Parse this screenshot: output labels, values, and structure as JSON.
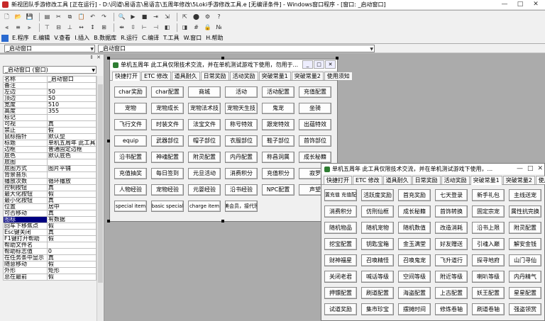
{
  "app_title": "新视团队手游修改工具 [正在运行] - D:\\问道\\易语言\\易语言\\五周年修改\\5Loki手游修改工具.e [无编译条件] - Windows窗口程序 - [窗口: _启动窗口]",
  "window_controls": [
    "—",
    "□",
    "✕"
  ],
  "toolbar1_icons": [
    "new-icon",
    "open-icon",
    "save-icon",
    "save-all-icon",
    "cut-icon",
    "copy-icon",
    "paste-icon",
    "undo-icon",
    "redo-icon",
    "find-icon",
    "run-icon",
    "stop-icon",
    "step-icon",
    "step-over-icon",
    "step-out-icon",
    "breakpoint-icon",
    "compile-icon",
    "help-icon"
  ],
  "toolbar1_glyphs": [
    "🗋",
    "📂",
    "💾",
    "▤",
    "✂",
    "⧉",
    "📋",
    "↶",
    "↷",
    "🔍",
    "▶",
    "■",
    "⇥",
    "⇲",
    "⇱",
    "⬤",
    "⚙",
    "?"
  ],
  "toolbar2_icons": [
    "align-left-icon",
    "align-center-icon",
    "align-right-icon",
    "align-top-icon",
    "align-middle-icon",
    "align-bottom-icon",
    "same-width-icon",
    "same-height-icon",
    "same-size-icon",
    "space-h-icon",
    "space-v-icon",
    "center-h-icon",
    "center-v-icon",
    "bring-front-icon",
    "send-back-icon",
    "grid-icon",
    "lock-icon",
    "tab-order-icon"
  ],
  "toolbar2_glyphs": [
    "⫷",
    "≡",
    "⫸",
    "⊤",
    "⊟",
    "⊥",
    "↔",
    "↕",
    "⊞",
    "⇹",
    "⇳",
    "⊢",
    "⊣",
    "◧",
    "◨",
    "#",
    "🔒",
    "№"
  ],
  "menu": [
    "E.程序",
    "E.编辑",
    "V.查看",
    "I.插入",
    "B.数据库",
    "R.运行",
    "C.编译",
    "T.工具",
    "W.窗口",
    "H.帮助"
  ],
  "object_combo": "_启动窗口",
  "event_combo": "_启动窗口",
  "panel_controls": [
    "⇕",
    "✕"
  ],
  "props_combo": "_启动窗口 (窗口)",
  "properties": [
    [
      "名称",
      "_启动窗口"
    ],
    [
      "备注",
      ""
    ],
    [
      "左边",
      "50"
    ],
    [
      "顶边",
      "50"
    ],
    [
      "宽度",
      "510"
    ],
    [
      "高度",
      "355"
    ],
    [
      "标记",
      ""
    ],
    [
      "可视",
      "真"
    ],
    [
      "禁止",
      "假"
    ],
    [
      "鼠标指针",
      "默认型"
    ],
    [
      "标题",
      "单机五周年 此工具"
    ],
    [
      "边框",
      "普通固定边框"
    ],
    [
      "底色",
      "默认底色"
    ],
    [
      "底图",
      ""
    ],
    [
      "底图方式",
      "图片平铺"
    ],
    [
      "背景音乐",
      ""
    ],
    [
      "播放次数",
      "循环播放"
    ],
    [
      "控制按钮",
      "真"
    ],
    [
      "最大化按钮",
      "假"
    ],
    [
      "最小化按钮",
      "真"
    ],
    [
      "位置",
      "居中"
    ],
    [
      "可否移动",
      "真"
    ],
    [
      "图标",
      "有数据"
    ],
    [
      "回车下移焦点",
      "假"
    ],
    [
      "Esc键关闭",
      "真"
    ],
    [
      "F1键打开帮助",
      "假"
    ],
    [
      "帮助文件名",
      ""
    ],
    [
      "帮助标志值",
      "0"
    ],
    [
      "在任务条中显示",
      "真"
    ],
    [
      "随意移动",
      "假"
    ],
    [
      "外形",
      "矩形"
    ],
    [
      "总在最前",
      "假"
    ]
  ],
  "form1": {
    "title": "单机五周年 此工具仅限技术交流，并在单机测试游戏下使用，勿用于...",
    "buttons_ctrl": [
      "_",
      "□",
      "✕"
    ],
    "tabs": [
      "快捷打开",
      "ETC 修改",
      "道具耐久",
      "日常奖励",
      "活动奖励",
      "突破常量1",
      "突破常量2",
      "使用须知"
    ],
    "buttons": [
      "char奖励",
      "char配置",
      "商城",
      "活动",
      "活动配置",
      "充值配置",
      "宠物",
      "宠物成长",
      "宠物法术技",
      "宠物天生技",
      "鬼宠",
      "坐骑",
      "飞行文件",
      "时装文件",
      "法宝文件",
      "称号特效",
      "跟宠特效",
      "出蕴特效",
      "equip",
      "武器部位",
      "帽子部位",
      "衣服部位",
      "鞋子部位",
      "首饰部位",
      "沿书配置",
      "神魂配置",
      "附灵配置",
      "内丹配置",
      "称昌洞属",
      "成长秘籍",
      "充值抽奖",
      "每日签到",
      "元旦活动",
      "消费积分",
      "充值积分",
      "寂罗",
      "人物经验",
      "宠物经验",
      "元婴经验",
      "沿书经验",
      "NPC配置",
      "声望",
      "special item",
      "basic special",
      "charge item",
      "蛛蛛团队搞完美会员，接代理系统~带功能",
      "",
      ""
    ]
  },
  "form2": {
    "title": "单机五周年 此工具仅限技术交流，并在单机测试游戏下使用，...",
    "buttons_ctrl": [
      "—",
      "□",
      "✕"
    ],
    "tabs": [
      "快捷打开",
      "ETC 修改",
      "道具耐久",
      "日常奖励",
      "活动奖励",
      "突破常量1",
      "突破常量2",
      "使用须知"
    ],
    "buttons": [
      "配置充值 充值配置",
      "活跃度奖励",
      "首充奖励",
      "七天登录",
      "新手礼包",
      "主线送宠",
      "消费积分",
      "仿刑仙框",
      "成长秘籍",
      "首饰转换",
      "固定宗宠",
      "属性抗完换",
      "随机物品",
      "随机宠物",
      "随机数值",
      "改造消耗",
      "沿书上限",
      "附灵配置",
      "挖宝配置",
      "钥匙宝箱",
      "金玉满堂",
      "好友赠送",
      "引魂入巅",
      "解安金钱",
      "财神福星",
      "召唤精怪",
      "召唤鬼宠",
      "飞升道行",
      "探寻地府",
      "山门寻仙",
      "关闭老君",
      "喊话等级",
      "空间等级",
      "附近等级",
      "喇叭等级",
      "内丹精气",
      "押镖配置",
      "刷道配置",
      "海盗配置",
      "上古配置",
      "妖王配置",
      "星星配置",
      "试道奖励",
      "集市珍宝",
      "摆摊时间",
      "修炼卷轴",
      "刷道卷轴",
      "强盗领赏"
    ]
  }
}
